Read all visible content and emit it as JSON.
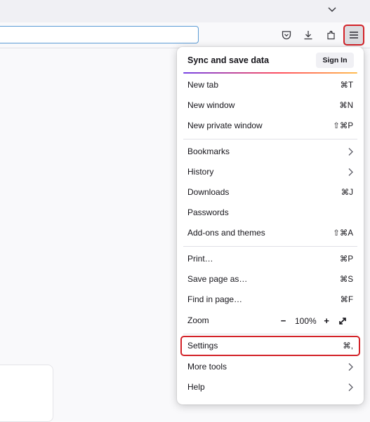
{
  "tabstrip": {
    "list_all_tabs_icon": "chevron-down-icon"
  },
  "toolbar": {
    "url_value": "",
    "buttons": [
      {
        "name": "pocket",
        "icon": "pocket-icon"
      },
      {
        "name": "downloads",
        "icon": "download-icon"
      },
      {
        "name": "extensions",
        "icon": "puzzle-icon"
      },
      {
        "name": "app-menu",
        "icon": "hamburger-icon",
        "active": true
      }
    ]
  },
  "menu": {
    "header_title": "Sync and save data",
    "sign_in_label": "Sign In",
    "items": {
      "new_tab": {
        "label": "New tab",
        "shortcut": "⌘T"
      },
      "new_window": {
        "label": "New window",
        "shortcut": "⌘N"
      },
      "new_private_window": {
        "label": "New private window",
        "shortcut": "⇧⌘P"
      },
      "bookmarks": {
        "label": "Bookmarks"
      },
      "history": {
        "label": "History"
      },
      "downloads": {
        "label": "Downloads",
        "shortcut": "⌘J"
      },
      "passwords": {
        "label": "Passwords"
      },
      "addons": {
        "label": "Add-ons and themes",
        "shortcut": "⇧⌘A"
      },
      "print": {
        "label": "Print…",
        "shortcut": "⌘P"
      },
      "save_page": {
        "label": "Save page as…",
        "shortcut": "⌘S"
      },
      "find": {
        "label": "Find in page…",
        "shortcut": "⌘F"
      },
      "zoom": {
        "label": "Zoom",
        "minus": "−",
        "level": "100%",
        "plus": "+"
      },
      "settings": {
        "label": "Settings",
        "shortcut": "⌘,",
        "highlighted": true
      },
      "more_tools": {
        "label": "More tools"
      },
      "help": {
        "label": "Help"
      }
    }
  },
  "colors": {
    "highlight_border": "#d32228",
    "url_focus_border": "#5b9bd5",
    "menu_background": "#ffffff",
    "page_background": "#f9f9fb"
  }
}
